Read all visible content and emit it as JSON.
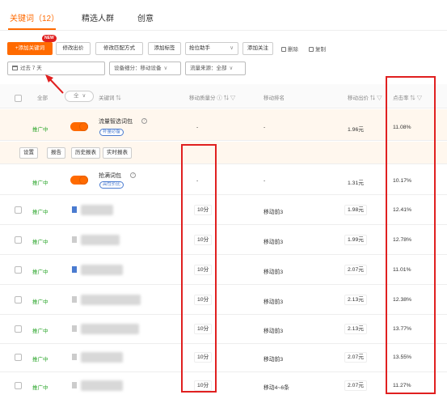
{
  "tabs": [
    {
      "label": "关键词（12）"
    },
    {
      "label": "精选人群"
    },
    {
      "label": "创意"
    }
  ],
  "toolbar": {
    "add_keyword": "+添加关键词",
    "new_badge": "NEW",
    "edit_bid": "修改出价",
    "edit_match": "修改匹配方式",
    "add_tag": "添加标签",
    "rank_helper": "抢位助手",
    "add_follow": "添加关注",
    "delete": "删除",
    "copy": "复制"
  },
  "filters": {
    "date_range": "过去 7 天",
    "device": "设备细分：移动设备",
    "traffic_source": "流量来源：全部"
  },
  "columns": {
    "all": "全部",
    "all_select": "全",
    "keyword": "关键词 ⇅",
    "mobile_quality": "移动质量分 ⓘ ⇅ ▽",
    "mobile_rank": "移动排名",
    "mobile_bid": "移动出价 ⇅ ▽",
    "ctr": "点击率 ⇅ ▽"
  },
  "sub_actions": [
    "设置",
    "报告",
    "历史报表",
    "实时报表"
  ],
  "rows": [
    {
      "status": "推广中",
      "keyword": "流量智选词包",
      "tag": "补量必备",
      "quality": "-",
      "rank": "-",
      "bid": "1.96元",
      "ctr": "11.08%"
    },
    {
      "status": "推广中",
      "keyword": "抢满词包",
      "tag": "高性价比",
      "quality": "-",
      "rank": "-",
      "bid": "1.31元",
      "ctr": "10.17%"
    },
    {
      "status": "推广中",
      "quality": "10分",
      "rank": "移动前3",
      "bid": "1.98元",
      "ctr": "12.41%"
    },
    {
      "status": "推广中",
      "quality": "10分",
      "rank": "移动前3",
      "bid": "1.99元",
      "ctr": "12.78%"
    },
    {
      "status": "推广中",
      "quality": "10分",
      "rank": "移动前3",
      "bid": "2.07元",
      "ctr": "11.01%"
    },
    {
      "status": "推广中",
      "quality": "10分",
      "rank": "移动前3",
      "bid": "2.13元",
      "ctr": "12.38%"
    },
    {
      "status": "推广中",
      "quality": "10分",
      "rank": "移动前3",
      "bid": "2.13元",
      "ctr": "13.77%"
    },
    {
      "status": "推广中",
      "quality": "10分",
      "rank": "移动前3",
      "bid": "2.07元",
      "ctr": "13.55%"
    },
    {
      "status": "推广中",
      "quality": "10分",
      "rank": "移动4~6条",
      "bid": "2.07元",
      "ctr": "11.27%"
    }
  ],
  "colors": {
    "accent": "#ff6a00",
    "status_green": "#2aa52a",
    "annotation_red": "#e02020",
    "tag_blue": "#4a7bd0"
  }
}
